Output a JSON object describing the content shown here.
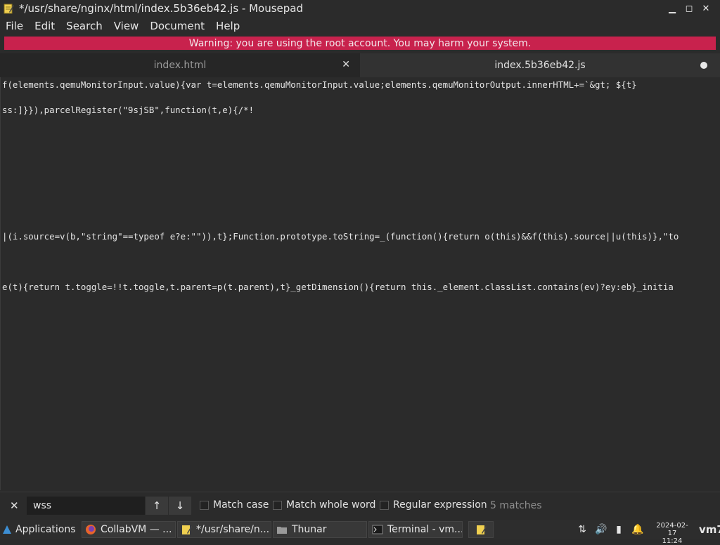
{
  "window": {
    "title": "*/usr/share/nginx/html/index.5b36eb42.js - Mousepad",
    "controls": {
      "minimize": "▁",
      "maximize": "◻",
      "close": "✕"
    }
  },
  "menu": [
    "File",
    "Edit",
    "Search",
    "View",
    "Document",
    "Help"
  ],
  "warning": "Warning: you are using the root account. You may harm your system.",
  "tabs": [
    {
      "label": "index.html",
      "close": "✕"
    },
    {
      "label": "index.5b36eb42.js"
    }
  ],
  "editor": {
    "lines": [
      "f(elements.qemuMonitorInput.value){var t=elements.qemuMonitorInput.value;elements.qemuMonitorOutput.innerHTML+=`&gt; ${t}",
      "",
      "ss:]}}),parcelRegister(\"9sjSB\",function(t,e){/*!",
      "",
      "",
      "",
      "",
      "",
      "",
      "",
      "|(i.source=v(b,\"string\"==typeof e?e:\"\")),t};Function.prototype.toString=_(function(){return o(this)&&f(this).source||u(this)},\"to",
      "",
      "",
      "",
      "e(t){return t.toggle=!!t.toggle,t.parent=p(t.parent),t}_getDimension(){return this._element.classList.contains(ev)?ey:eb}_initia"
    ]
  },
  "search": {
    "close": "✕",
    "query": "wss",
    "prev": "↑",
    "next": "↓",
    "match_case": "Match case",
    "match_whole_word": "Match whole word",
    "regular_expression": "Regular expression",
    "matches": "5 matches"
  },
  "taskbar": {
    "applications": "Applications",
    "tasks": [
      {
        "label": "CollabVM — ...",
        "icon": "firefox-icon"
      },
      {
        "label": "*/usr/share/n...",
        "icon": "mousepad-icon"
      },
      {
        "label": "Thunar",
        "icon": "folder-icon"
      },
      {
        "label": "Terminal - vm...",
        "icon": "terminal-icon"
      }
    ],
    "clock_date": "2024-02-17",
    "clock_time": "11:24",
    "user": "vm7"
  },
  "colors": {
    "warning_bg": "#c8224d",
    "editor_bg": "#2b2b2b",
    "taskbar_bg": "#2d2d2d"
  }
}
